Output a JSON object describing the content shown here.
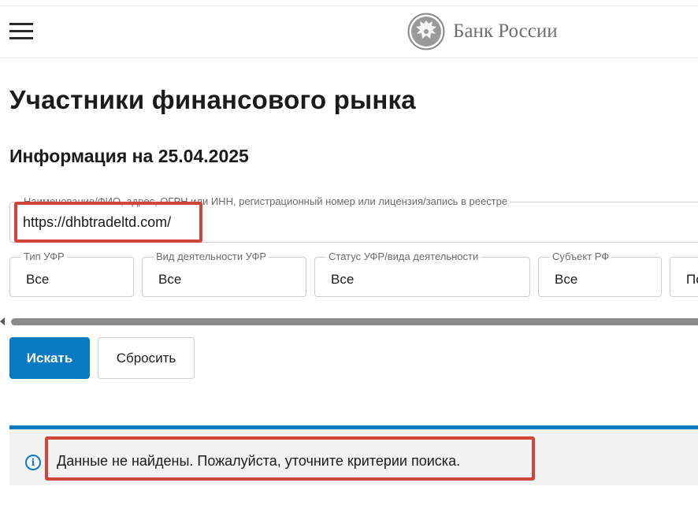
{
  "header": {
    "logo_text": "Банк России",
    "logo_icon": "eagle-emblem-icon",
    "menu_icon": "hamburger-menu-icon"
  },
  "main": {
    "title": "Участники финансового рынка",
    "info_date": "Информация на 25.04.2025"
  },
  "search": {
    "label": "Наименование/ФИО, адрес, ОГРН или ИНН, регистрационный номер или лицензия/запись в реестре",
    "value": "https://dhbtradeltd.com/"
  },
  "filters": [
    {
      "label": "Тип УФР",
      "value": "Все"
    },
    {
      "label": "Вид деятельности УФР",
      "value": "Все"
    },
    {
      "label": "Статус УФР/вида деятельности",
      "value": "Все"
    },
    {
      "label": "Субъект РФ",
      "value": "Все"
    },
    {
      "label": "",
      "value": "По"
    }
  ],
  "buttons": {
    "search": "Искать",
    "reset": "Сбросить"
  },
  "notice": {
    "text": "Данные не найдены. Пожалуйста, уточните критерии поиска.",
    "icon": "info-icon"
  },
  "colors": {
    "accent": "#0a7ac3",
    "highlight": "#d0453a",
    "notice_bg": "#f2f2f2"
  }
}
